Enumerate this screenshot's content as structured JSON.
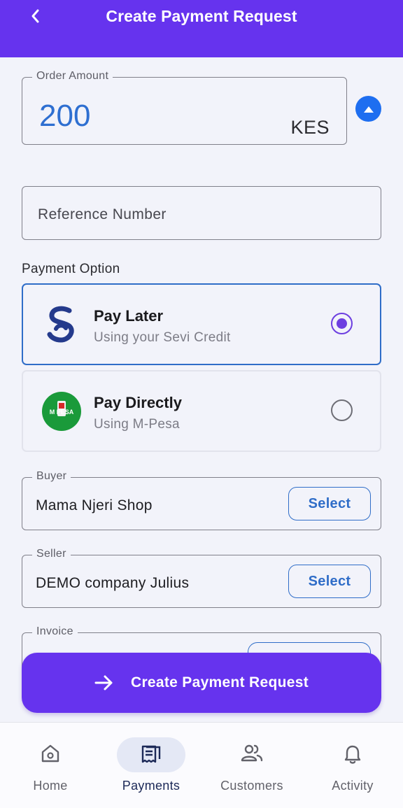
{
  "header": {
    "title": "Create Payment Request",
    "back_icon": "chevron-left-icon"
  },
  "amount": {
    "label": "Order Amount",
    "value": "200",
    "currency": "KES"
  },
  "reference": {
    "placeholder": "Reference Number"
  },
  "payment": {
    "section_label": "Payment Option",
    "options": [
      {
        "title": "Pay Later",
        "subtitle": "Using your Sevi Credit",
        "icon": "sevi-logo-icon",
        "selected": true
      },
      {
        "title": "Pay Directly",
        "subtitle": "Using M-Pesa",
        "icon": "mpesa-logo-icon",
        "logo_text": "M PESA",
        "selected": false
      }
    ]
  },
  "buyer": {
    "label": "Buyer",
    "value": "Mama Njeri Shop",
    "button": "Select"
  },
  "seller": {
    "label": "Seller",
    "value": "DEMO company Julius",
    "button": "Select"
  },
  "invoice": {
    "label": "Invoice"
  },
  "primary_action": {
    "label": "Create Payment Request",
    "icon": "arrow-right-icon"
  },
  "nav": {
    "items": [
      {
        "label": "Home",
        "icon": "home-icon",
        "active": false
      },
      {
        "label": "Payments",
        "icon": "receipt-icon",
        "active": true
      },
      {
        "label": "Customers",
        "icon": "people-icon",
        "active": false
      },
      {
        "label": "Activity",
        "icon": "bell-icon",
        "active": false
      }
    ]
  },
  "colors": {
    "brand": "#6633ee",
    "accent_blue": "#2f6dc8",
    "amount_blue": "#2e6fd1",
    "mpesa_green": "#1a9a3a"
  }
}
